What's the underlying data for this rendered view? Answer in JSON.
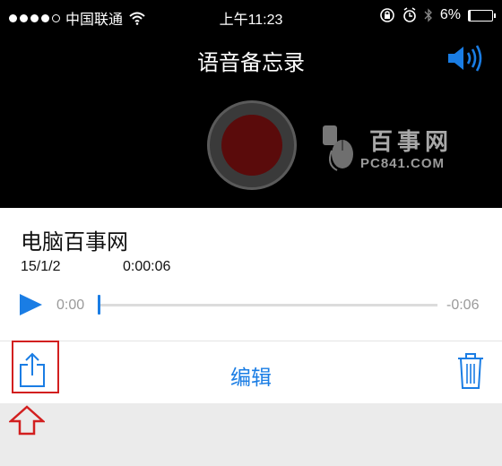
{
  "status_bar": {
    "carrier": "中国联通",
    "time": "上午11:23",
    "battery": "6%"
  },
  "header": {
    "title": "语音备忘录"
  },
  "watermark": {
    "title": "百事网",
    "url": "PC841.COM"
  },
  "recording": {
    "name": "电脑百事网",
    "date": "15/1/2",
    "duration": "0:00:06",
    "current_time": "0:00",
    "remaining_time": "-0:06",
    "progress": 0
  },
  "toolbar": {
    "edit_label": "编辑"
  },
  "colors": {
    "accent": "#1a7de4",
    "record_red": "#5a0b0b",
    "highlight": "#d21f1f"
  },
  "icons": [
    "wifi-icon",
    "lock-rotation-icon",
    "alarm-icon",
    "bluetooth-icon",
    "battery-icon",
    "speaker-icon",
    "record-icon",
    "play-icon",
    "share-icon",
    "trash-icon",
    "up-arrow-icon"
  ]
}
